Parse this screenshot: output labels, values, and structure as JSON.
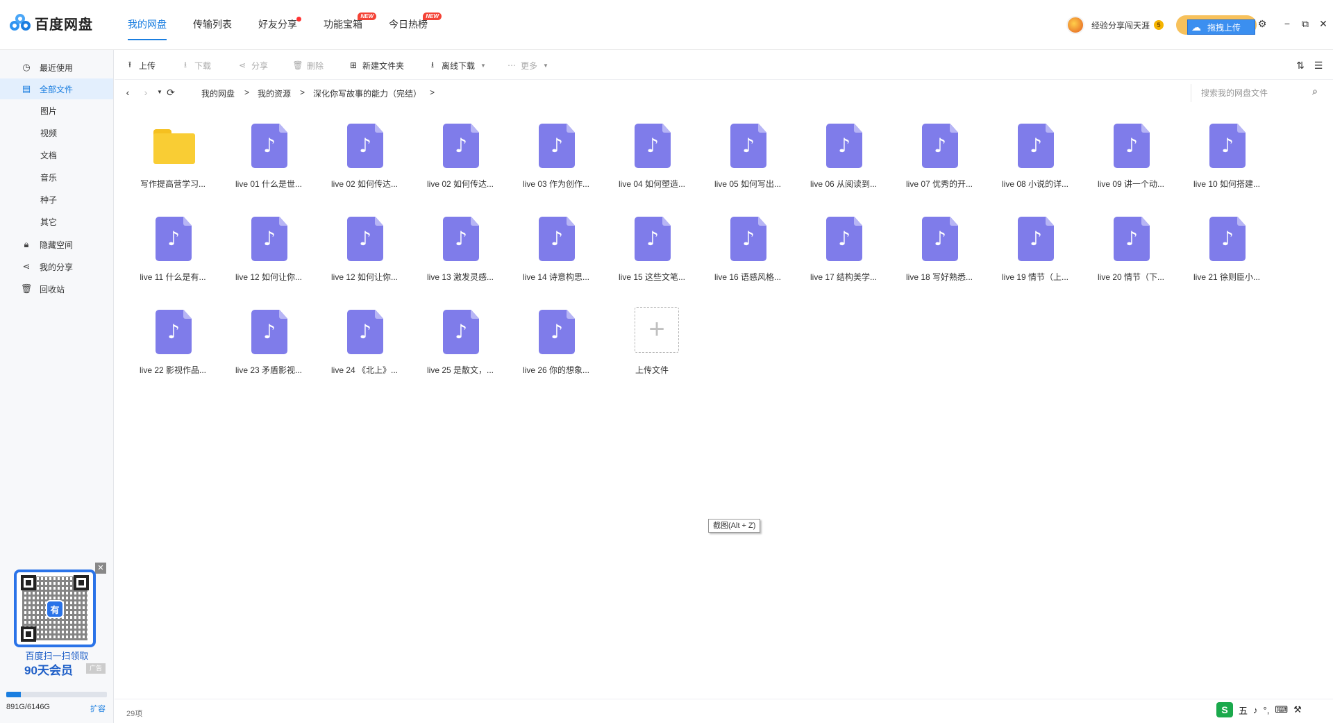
{
  "app": {
    "logo_text": "百度网盘"
  },
  "nav": {
    "tabs": [
      {
        "label": "我的网盘",
        "active": true
      },
      {
        "label": "传输列表"
      },
      {
        "label": "好友分享",
        "dot": true
      },
      {
        "label": "功能宝箱",
        "badge": "NEW"
      },
      {
        "label": "今日热榜",
        "badge": "NEW"
      }
    ]
  },
  "user": {
    "name": "经验分享闯天涯",
    "vip_badge": "5"
  },
  "upload_float": {
    "label": "拖拽上传"
  },
  "window_controls": [
    "gear-icon",
    "minimize-icon",
    "restore-icon",
    "close-icon"
  ],
  "sidebar": {
    "items": [
      {
        "label": "最近使用",
        "icon": "clock-icon"
      },
      {
        "label": "全部文件",
        "icon": "file-icon",
        "active": true
      },
      {
        "label": "图片"
      },
      {
        "label": "视频"
      },
      {
        "label": "文档"
      },
      {
        "label": "音乐"
      },
      {
        "label": "种子"
      },
      {
        "label": "其它"
      },
      {
        "label": "隐藏空间",
        "icon": "lock-icon"
      },
      {
        "label": "我的分享",
        "icon": "share-icon"
      },
      {
        "label": "回收站",
        "icon": "trash-icon"
      }
    ],
    "promo": {
      "line1": "百度扫一扫领取",
      "line2": "90天会员",
      "ad_tag": "广告",
      "qr_center": "有"
    },
    "quota": {
      "text": "891G/6146G",
      "used_fraction": 0.145,
      "expand_label": "扩容"
    }
  },
  "toolbar": {
    "upload": "上传",
    "download": "下载",
    "share": "分享",
    "delete": "删除",
    "new_folder": "新建文件夹",
    "offline_download": "离线下载",
    "more": "更多"
  },
  "breadcrumb": {
    "items": [
      "我的网盘",
      "我的资源",
      "深化你写故事的能力（完结）"
    ],
    "separator": ">",
    "search_placeholder": "搜索我的网盘文件"
  },
  "files": [
    {
      "name": "写作提高营学习...",
      "type": "folder"
    },
    {
      "name": "live 01 什么是世...",
      "type": "audio"
    },
    {
      "name": "live 02 如何传达...",
      "type": "audio"
    },
    {
      "name": "live 02 如何传达...",
      "type": "audio"
    },
    {
      "name": "live 03 作为创作...",
      "type": "audio"
    },
    {
      "name": "live 04 如何塑造...",
      "type": "audio"
    },
    {
      "name": "live 05 如何写出...",
      "type": "audio"
    },
    {
      "name": "live 06 从阅读到...",
      "type": "audio"
    },
    {
      "name": "live 07 优秀的开...",
      "type": "audio"
    },
    {
      "name": "live 08 小说的详...",
      "type": "audio"
    },
    {
      "name": "live 09 讲一个动...",
      "type": "audio"
    },
    {
      "name": "live 10 如何搭建...",
      "type": "audio"
    },
    {
      "name": "live 11 什么是有...",
      "type": "audio"
    },
    {
      "name": "live 12 如何让你...",
      "type": "audio"
    },
    {
      "name": "live 12 如何让你...",
      "type": "audio"
    },
    {
      "name": "live 13 激发灵感...",
      "type": "audio"
    },
    {
      "name": "live 14 诗意构思...",
      "type": "audio"
    },
    {
      "name": "live 15 这些文笔...",
      "type": "audio"
    },
    {
      "name": "live 16 语感风格...",
      "type": "audio"
    },
    {
      "name": "live 17 结构美学...",
      "type": "audio"
    },
    {
      "name": "live 18 写好熟悉...",
      "type": "audio"
    },
    {
      "name": "live 19 情节（上...",
      "type": "audio"
    },
    {
      "name": "live 20 情节（下...",
      "type": "audio"
    },
    {
      "name": "live 21 徐则臣小...",
      "type": "audio"
    },
    {
      "name": "live 22 影视作品...",
      "type": "audio"
    },
    {
      "name": "live 23 矛盾影视...",
      "type": "audio"
    },
    {
      "name": "live 24 《北上》...",
      "type": "audio"
    },
    {
      "name": "live 25 是散文，...",
      "type": "audio"
    },
    {
      "name": "live 26 你的想象...",
      "type": "audio"
    },
    {
      "name": "上传文件",
      "type": "upload"
    }
  ],
  "tooltip": "截图(Alt + Z)",
  "status": {
    "count": "29项"
  },
  "ime": {
    "logo": "S",
    "items": [
      "五",
      "♪",
      "°,",
      "⌨",
      "⚒"
    ]
  },
  "colors": {
    "accent": "#1a7ee0",
    "audio_icon": "#7f7cea",
    "folder": "#f9cd34",
    "new_badge": "#f44336"
  }
}
